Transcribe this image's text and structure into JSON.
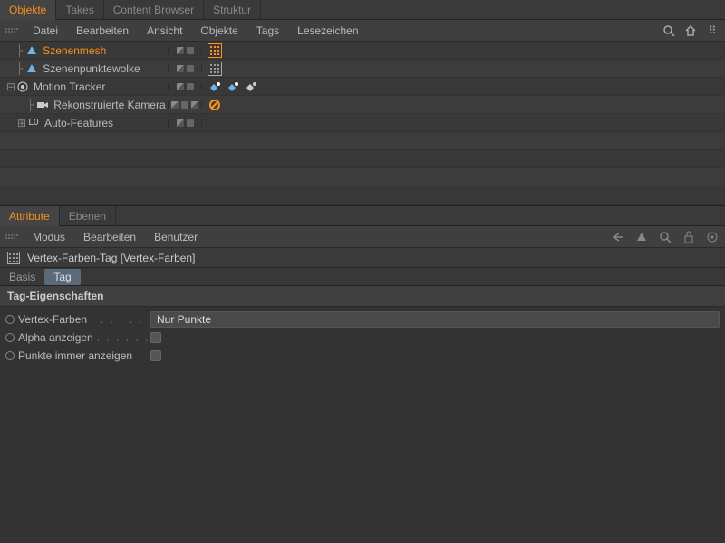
{
  "topTabs": [
    "Objekte",
    "Takes",
    "Content Browser",
    "Struktur"
  ],
  "topTabActive": 0,
  "topMenus": [
    "Datei",
    "Bearbeiten",
    "Ansicht",
    "Objekte",
    "Tags",
    "Lesezeichen"
  ],
  "tree": [
    {
      "indent": 0,
      "branch": "├",
      "icon": "mesh",
      "label": "Szenenmesh",
      "active": true,
      "tags": [
        "vertex-active"
      ]
    },
    {
      "indent": 0,
      "branch": "├",
      "icon": "mesh",
      "label": "Szenenpunktewolke",
      "active": false,
      "tags": [
        "vertex-dim"
      ]
    },
    {
      "indent": 0,
      "branch": "",
      "expander": "⊟",
      "icon": "tracker",
      "label": "Motion Tracker",
      "active": false,
      "tags": [
        "solver",
        "solver",
        "solver"
      ]
    },
    {
      "indent": 1,
      "branch": "├",
      "icon": "camera",
      "label": "Rekonstruierte Kamera",
      "active": false,
      "midExtra": true,
      "tags": [
        "no"
      ]
    },
    {
      "indent": 1,
      "branch": "",
      "expander": "⊞",
      "icon": "features",
      "label": "Auto-Features",
      "active": false,
      "tags": []
    }
  ],
  "bottomTabs": [
    "Attribute",
    "Ebenen"
  ],
  "bottomTabActive": 0,
  "bottomMenus": [
    "Modus",
    "Bearbeiten",
    "Benutzer"
  ],
  "attrTitle": "Vertex-Farben-Tag [Vertex-Farben]",
  "subTabs": [
    "Basis",
    "Tag"
  ],
  "subTabActive": 1,
  "sectionHeader": "Tag-Eigenschaften",
  "props": {
    "vertexFarben": {
      "label": "Vertex-Farben",
      "value": "Nur Punkte"
    },
    "alphaAnzeigen": {
      "label": "Alpha anzeigen",
      "checked": false
    },
    "punkteImmer": {
      "label": "Punkte immer anzeigen",
      "checked": false
    }
  }
}
